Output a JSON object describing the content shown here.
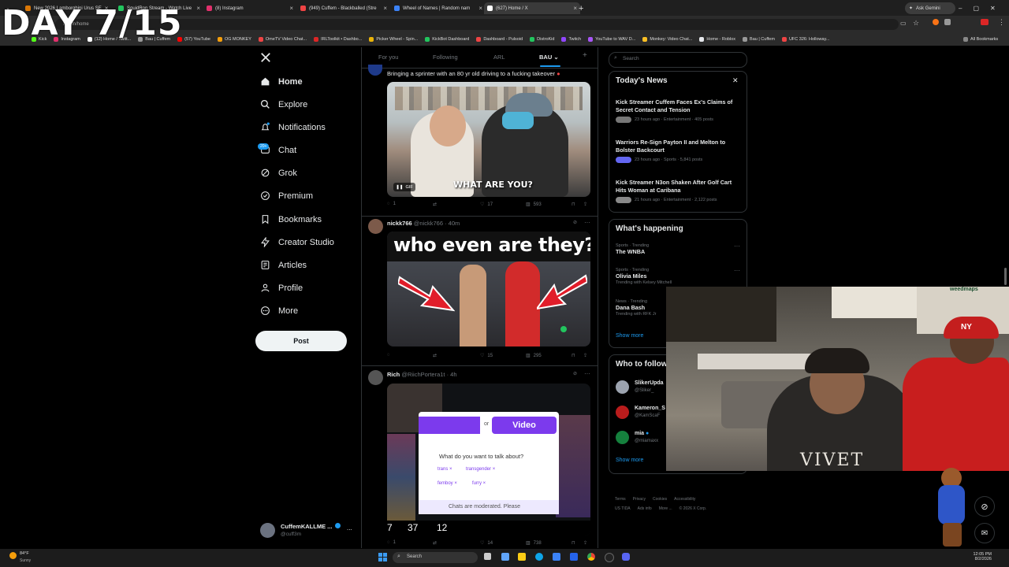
{
  "overlay": {
    "day_counter": "DAY 7/15"
  },
  "browser": {
    "tabs": [
      {
        "label": "New 2026 Lamborghini Urus SE",
        "color": "#d97706"
      },
      {
        "label": "SquidRon Stream - Watch Live",
        "color": "#22c55e"
      },
      {
        "label": "(8) Instagram",
        "color": "#e1306c"
      },
      {
        "label": "(949) Cuffem - Blackballed (Stre",
        "color": "#ef4444"
      },
      {
        "label": "Wheel of Names | Random nam",
        "color": "#3b82f6"
      },
      {
        "label": "(627) Home / X",
        "color": "#ffffff"
      }
    ],
    "ask_gemini": "Ask Gemini",
    "address": "x.com/home",
    "bookmarks": [
      "Kick",
      "Instagram",
      "(12) Home / Twitt...",
      "Bau | Cuffem",
      "(57) YouTube",
      "OG MONKEY",
      "OmeTV Video Chat...",
      "IRLToolkit • Dashbo...",
      "Picker Wheel - Spin...",
      "KickBot Dashboard",
      "Dashboard - Pulsoid",
      "DistroKid",
      "Twitch",
      "YouTube to WAV D...",
      "Monkey: Video Chat...",
      "Home - Roblox",
      "Bau | Cuffem",
      "UFC 326: Holloway..."
    ],
    "all_bookmarks": "All Bookmarks"
  },
  "nav": {
    "items": [
      "Home",
      "Explore",
      "Notifications",
      "Chat",
      "Grok",
      "Premium",
      "Bookmarks",
      "Creator Studio",
      "Articles",
      "Profile",
      "More"
    ],
    "chat_badge": "20+",
    "post_label": "Post"
  },
  "account": {
    "name": "CuffemKALLME ...",
    "handle": "@cuff3m",
    "more": "..."
  },
  "feed": {
    "tabs": [
      "For you",
      "Following",
      "ARL",
      "BAU"
    ],
    "tweets": [
      {
        "text": "Bringing a sprinter with an 80 yr old driving to a fucking takeover",
        "caption": "WHAT ARE YOU?",
        "gif": "GIF",
        "stats": {
          "replies": "1",
          "likes": "17",
          "views": "593"
        }
      },
      {
        "name": "nickk766",
        "meta": "@nickk766 · 40m",
        "thumb_text": "who even are they?",
        "stats": {
          "likes": "15",
          "views": "295"
        }
      },
      {
        "name": "Rich",
        "meta": "@RiichPortera1t · 4h",
        "screen": {
          "or": "or",
          "video": "Video",
          "question": "What do you want to talk about?",
          "chips": [
            "trans ×",
            "transgender ×",
            "femboy ×",
            "furry ×"
          ],
          "moderated": "Chats are moderated. Please",
          "counts": [
            "7",
            "37",
            "12"
          ]
        },
        "stats": {
          "replies": "1",
          "likes": "14",
          "views": "738"
        }
      }
    ]
  },
  "right": {
    "search_placeholder": "Search",
    "todays_news": {
      "title": "Today's News",
      "items": [
        {
          "title": "Kick Streamer Cuffem Faces Ex's Claims of Secret Contact and Tension",
          "meta": "23 hours ago · Entertainment · 405 posts"
        },
        {
          "title": "Warriors Re-Sign Payton II and Melton to Bolster Backcourt",
          "meta": "23 hours ago · Sports · 5,841 posts"
        },
        {
          "title": "Kick Streamer N3on Shaken After Golf Cart Hits Woman at Caribana",
          "meta": "21 hours ago · Entertainment · 2,122 posts"
        }
      ]
    },
    "whats_happening": {
      "title": "What's happening",
      "items": [
        {
          "context": "Sports · Trending",
          "topic": "The WNBA",
          "extra": ""
        },
        {
          "context": "Sports · Trending",
          "topic": "Olivia Miles",
          "extra": "Trending with Kelsey Mitchell"
        },
        {
          "context": "News · Trending",
          "topic": "Dana Bash",
          "extra": "Trending with RFK Jr"
        }
      ],
      "show_more": "Show more"
    },
    "who_to_follow": {
      "title": "Who to follow",
      "items": [
        {
          "name": "SlikerUpda",
          "handle": "@Sliker_"
        },
        {
          "name": "Kameron_S",
          "handle": "@KamScaF"
        },
        {
          "name": "mia",
          "handle": "@miamaxx"
        }
      ],
      "show_more": "Show more"
    },
    "footer": [
      "Terms",
      "Privacy",
      "Cookies",
      "Accessibility",
      "Ads info",
      "More ...",
      "© 2026 X Corp."
    ],
    "footer_region": "US TIDA"
  },
  "webcam": {
    "shirt_text": "VIVET",
    "sign_text": "weedmaps"
  },
  "taskbar": {
    "weather_temp": "84°F",
    "weather_desc": "Sunny",
    "search": "Search",
    "time": "12:05 PM",
    "date": "8/2/2026"
  },
  "colors": {
    "accent": "#1d9bf0",
    "post_bg": "#eff3f4",
    "border": "#2f3336",
    "muted": "#71767b"
  }
}
